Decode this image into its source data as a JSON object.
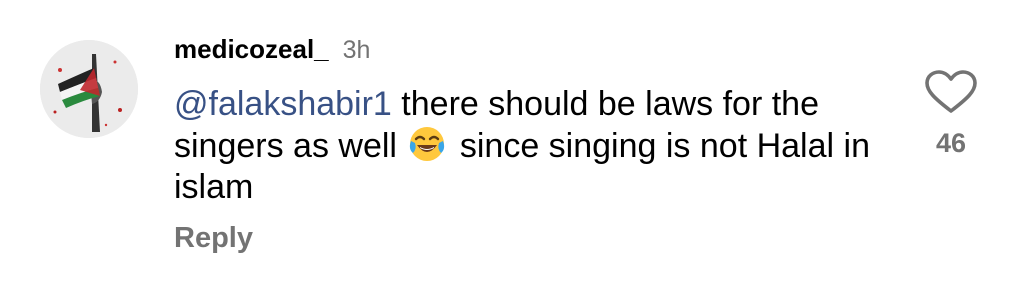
{
  "comment": {
    "username": "medicozeal_",
    "time": "3h",
    "mention": "@falakshabir1",
    "text_part1": " there should be laws for the singers as well ",
    "emoji": "face-with-tears-of-joy-emoji",
    "text_part2": " since singing is not Halal in islam",
    "reply_label": "Reply",
    "like_count": "46",
    "like_icon": "heart-outline-icon",
    "colors": {
      "text": "#000000",
      "muted": "#737373",
      "mention": "#385185"
    }
  }
}
